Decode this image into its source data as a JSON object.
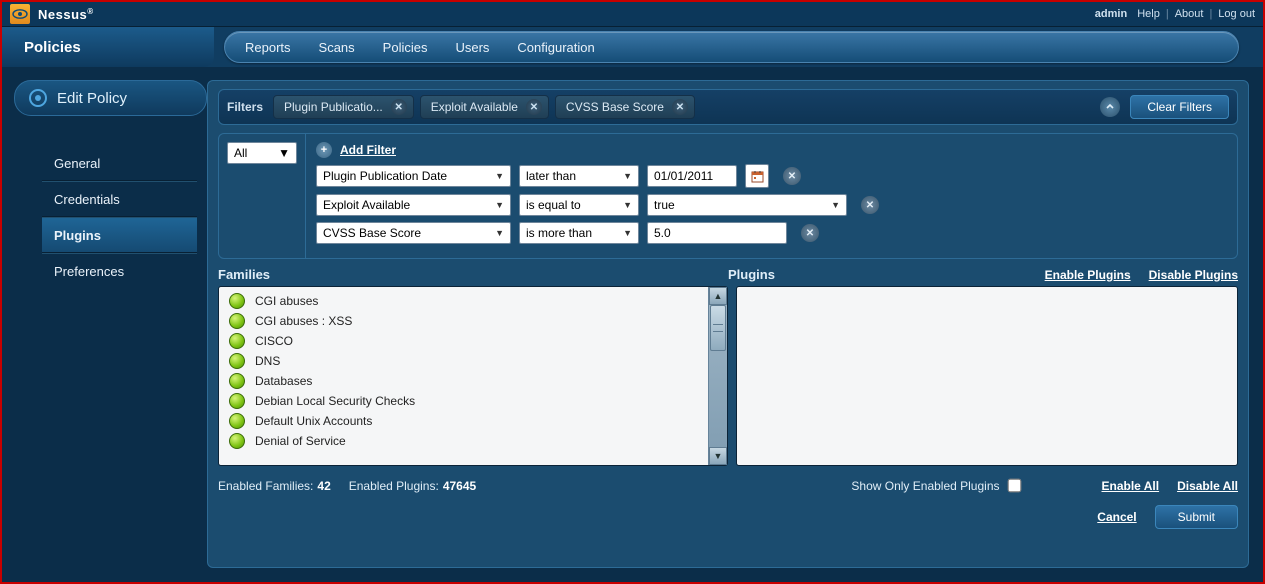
{
  "brand": "Nessus",
  "topLinks": {
    "user": "admin",
    "help": "Help",
    "about": "About",
    "logout": "Log out"
  },
  "section": "Policies",
  "nav": [
    "Reports",
    "Scans",
    "Policies",
    "Users",
    "Configuration"
  ],
  "sidebar": {
    "title": "Edit Policy",
    "items": [
      "General",
      "Credentials",
      "Plugins",
      "Preferences"
    ],
    "activeIndex": 2
  },
  "filtersBar": {
    "label": "Filters",
    "chips": [
      "Plugin Publicatio...",
      "Exploit Available",
      "CVSS Base Score"
    ],
    "clear": "Clear Filters"
  },
  "filterBuilder": {
    "scope": "All",
    "addFilter": "Add Filter",
    "rows": [
      {
        "field": "Plugin Publication Date",
        "op": "later than",
        "value": "01/01/2011",
        "type": "date"
      },
      {
        "field": "Exploit Available",
        "op": "is equal to",
        "value": "true",
        "type": "select"
      },
      {
        "field": "CVSS Base Score",
        "op": "is more than",
        "value": "5.0",
        "type": "number"
      }
    ]
  },
  "pluginArea": {
    "familiesHeader": "Families",
    "pluginsHeader": "Plugins",
    "enablePlugins": "Enable Plugins",
    "disablePlugins": "Disable Plugins",
    "families": [
      "CGI abuses",
      "CGI abuses : XSS",
      "CISCO",
      "DNS",
      "Databases",
      "Debian Local Security Checks",
      "Default Unix Accounts",
      "Denial of Service"
    ],
    "enabledFamiliesLabel": "Enabled Families:",
    "enabledFamiliesCount": "42",
    "enabledPluginsLabel": "Enabled Plugins:",
    "enabledPluginsCount": "47645",
    "showOnlyEnabled": "Show Only Enabled Plugins",
    "showOnlyEnabledChecked": false,
    "enableAll": "Enable All",
    "disableAll": "Disable All"
  },
  "footer": {
    "cancel": "Cancel",
    "submit": "Submit"
  }
}
